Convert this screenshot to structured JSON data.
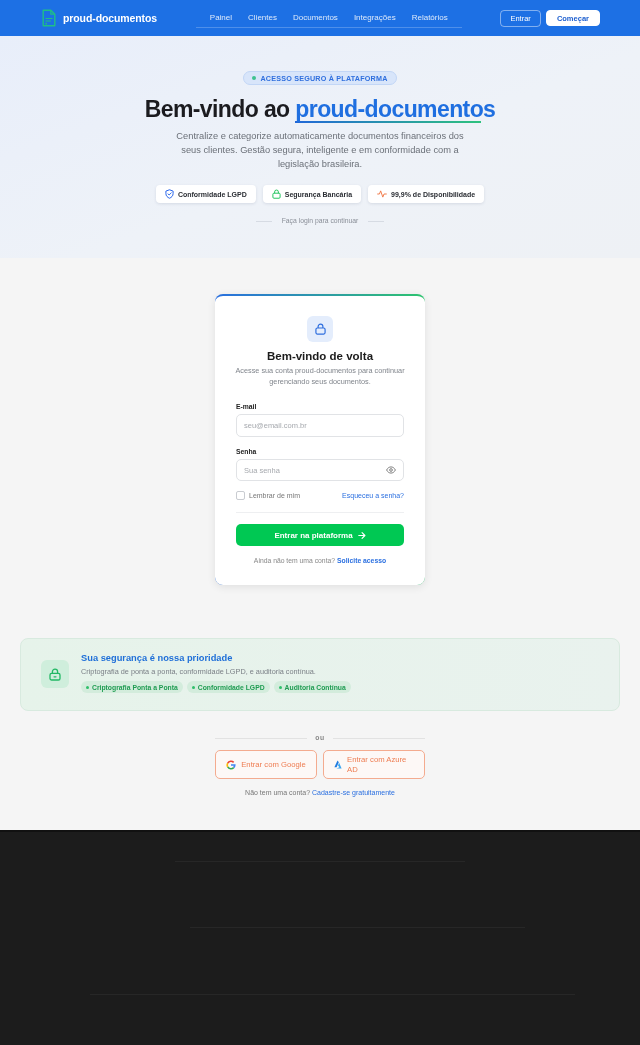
{
  "header": {
    "brand": "proud-documentos",
    "nav": [
      {
        "label": "Painel"
      },
      {
        "label": "Clientes"
      },
      {
        "label": "Documentos"
      },
      {
        "label": "Integrações"
      },
      {
        "label": "Relatórios"
      }
    ],
    "buttons": [
      {
        "label": "Entrar",
        "kind": "outline"
      },
      {
        "label": "Começar",
        "kind": "solid"
      }
    ]
  },
  "hero": {
    "badge": "ACESSO SEGURO À PLATAFORMA",
    "title": "Bem-vindo ao",
    "title_highlight": "proud-documentos",
    "description": "Centralize e categorize automaticamente documentos financeiros dos seus clientes. Gestão segura, inteligente e em conformidade com a legislação brasileira.",
    "features": [
      {
        "label": "Conformidade LGPD",
        "kind": "shield"
      },
      {
        "label": "Segurança Bancária",
        "kind": "lock"
      },
      {
        "label": "99,9% de Disponibilidade",
        "kind": "pulse"
      }
    ],
    "divider_text": "Faça login para continuar"
  },
  "login": {
    "title": "Bem-vindo de volta",
    "subtitle": "Acesse sua conta proud-documentos para continuar gerenciando seus documentos.",
    "fields": [
      {
        "label": "E-mail",
        "placeholder": "seu@email.com.br",
        "kind": "email"
      },
      {
        "label": "Senha",
        "placeholder": "Sua senha",
        "kind": "password"
      }
    ],
    "remember": {
      "label": "Lembrar de mim",
      "checked": false
    },
    "forgot_link": "Esqueceu a senha?",
    "submit": "Entrar na plataforma",
    "signup_prompt": "Ainda não tem uma conta?",
    "signup_link": "Solicite acesso"
  },
  "security": {
    "title": "Sua segurança é nossa prioridade",
    "text": "Criptografia de ponta a ponta, conformidade LGPD, e auditoria contínua.",
    "tags": [
      "Criptografia Ponta a Ponta",
      "Conformidade LGPD",
      "Auditoria Contínua"
    ]
  },
  "alternatives": {
    "divider": "ou",
    "providers": [
      {
        "label": "Entrar com Google",
        "kind": "google"
      },
      {
        "label": "Entrar com Azure AD",
        "kind": "azure"
      }
    ],
    "signup_prompt": "Não tem uma conta?",
    "signup_link": "Cadastre-se gratuitamente"
  }
}
